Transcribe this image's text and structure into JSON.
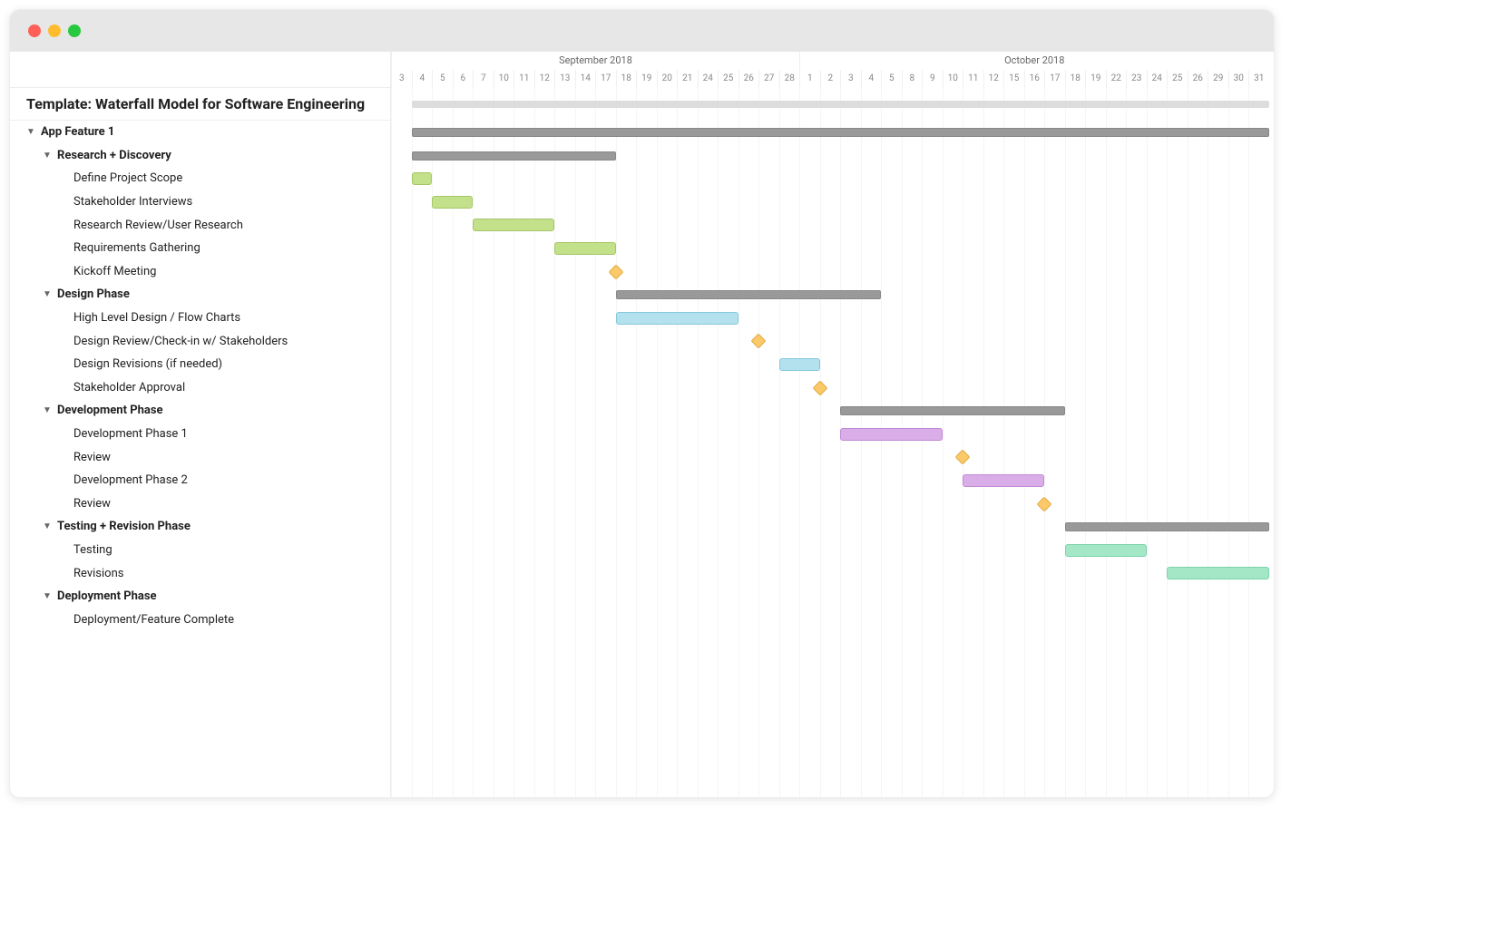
{
  "chart_data": {
    "type": "gantt",
    "title": "Template: Waterfall Model for Software Engineering",
    "timeline": {
      "months": [
        {
          "label": "September 2018",
          "days": [
            3,
            4,
            5,
            6,
            7,
            10,
            11,
            12,
            13,
            14,
            17,
            18,
            19,
            20,
            21,
            24,
            25,
            26,
            27,
            28
          ]
        },
        {
          "label": "October 2018",
          "days": [
            1,
            2,
            3,
            4,
            5,
            8,
            9,
            10,
            11,
            12,
            15,
            16,
            17,
            18,
            19,
            22,
            23,
            24,
            25,
            26,
            29,
            30,
            31
          ]
        }
      ]
    },
    "rows": [
      {
        "label": "App Feature 1",
        "type": "group",
        "indent": 0,
        "start": 1,
        "end": 43
      },
      {
        "label": "Research + Discovery",
        "type": "group",
        "indent": 1,
        "start": 1,
        "end": 11
      },
      {
        "label": "Define Project Scope",
        "type": "task",
        "color": "green",
        "indent": 2,
        "start": 1,
        "end": 2
      },
      {
        "label": "Stakeholder Interviews",
        "type": "task",
        "color": "green",
        "indent": 2,
        "start": 2,
        "end": 4
      },
      {
        "label": "Research Review/User Research",
        "type": "task",
        "color": "green",
        "indent": 2,
        "start": 4,
        "end": 8
      },
      {
        "label": "Requirements Gathering",
        "type": "task",
        "color": "green",
        "indent": 2,
        "start": 8,
        "end": 11
      },
      {
        "label": "Kickoff Meeting",
        "type": "milestone",
        "indent": 2,
        "at": 11
      },
      {
        "label": "Design Phase",
        "type": "group",
        "indent": 1,
        "start": 11,
        "end": 24
      },
      {
        "label": "High Level Design / Flow Charts",
        "type": "task",
        "color": "blue",
        "indent": 2,
        "start": 11,
        "end": 17
      },
      {
        "label": "Design Review/Check-in w/ Stakeholders",
        "type": "milestone",
        "indent": 2,
        "at": 18
      },
      {
        "label": "Design Revisions (if needed)",
        "type": "task",
        "color": "blue",
        "indent": 2,
        "start": 19,
        "end": 21
      },
      {
        "label": "Stakeholder Approval",
        "type": "milestone",
        "indent": 2,
        "at": 21
      },
      {
        "label": "Development Phase",
        "type": "group",
        "indent": 1,
        "start": 22,
        "end": 33
      },
      {
        "label": "Development Phase 1",
        "type": "task",
        "color": "purple",
        "indent": 2,
        "start": 22,
        "end": 27
      },
      {
        "label": "Review",
        "type": "milestone",
        "indent": 2,
        "at": 28
      },
      {
        "label": "Development Phase 2",
        "type": "task",
        "color": "purple",
        "indent": 2,
        "start": 28,
        "end": 32
      },
      {
        "label": "Review",
        "type": "milestone",
        "indent": 2,
        "at": 32
      },
      {
        "label": "Testing + Revision Phase",
        "type": "group",
        "indent": 1,
        "start": 33,
        "end": 43
      },
      {
        "label": "Testing",
        "type": "task",
        "color": "mint",
        "indent": 2,
        "start": 33,
        "end": 37
      },
      {
        "label": "Revisions",
        "type": "task",
        "color": "mint",
        "indent": 2,
        "start": 38,
        "end": 43
      },
      {
        "label": "Deployment Phase",
        "type": "group-label",
        "indent": 1
      },
      {
        "label": "Deployment/Feature Complete",
        "type": "label",
        "indent": 2
      }
    ]
  }
}
